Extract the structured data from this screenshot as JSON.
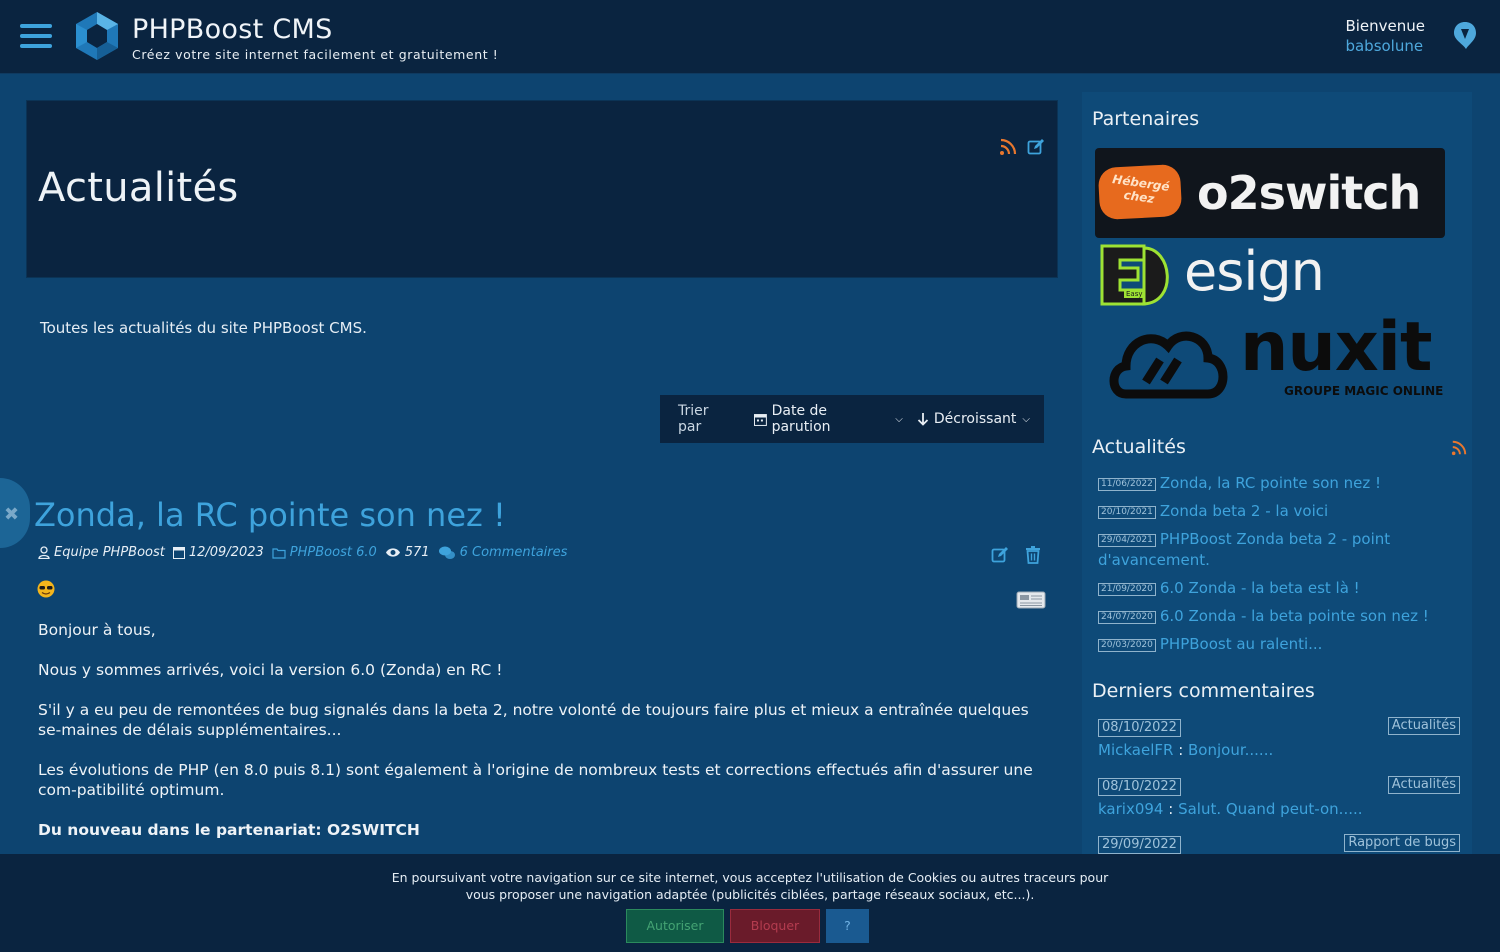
{
  "header": {
    "site_title": "PHPBoost CMS",
    "site_subtitle": "Créez votre site internet facilement et gratuitement !",
    "welcome": "Bienvenue",
    "username": "babsolune"
  },
  "main": {
    "page_title": "Actualités",
    "intro": "Toutes les actualités du site PHPBoost CMS.",
    "sort": {
      "label": "Trier par",
      "field": "Date de parution",
      "order": "Décroissant"
    },
    "article": {
      "title": "Zonda, la RC pointe son nez !",
      "author": "Equipe PHPBoost",
      "date": "12/09/2023",
      "category": "PHPBoost 6.0",
      "views": "571",
      "comments": "6 Commentaires",
      "paragraphs": [
        "Bonjour à tous,",
        "Nous y sommes arrivés, voici la version 6.0 (Zonda) en RC !",
        "S'il y a eu peu de remontées de bug signalés dans la beta 2, notre volonté de toujours faire plus et mieux a entraînée quelques se-maines de délais supplémentaires...",
        "Les évolutions de PHP (en 8.0 puis 8.1) sont également à l'origine de nombreux tests et corrections effectués afin d'assurer une com-patibilité optimum."
      ],
      "subheading": "Du nouveau dans le partenariat: O2SWITCH"
    }
  },
  "sidebar": {
    "partners_title": "Partenaires",
    "partners": {
      "o2switch_tag": "Hébergé chez",
      "o2switch_name": "o2switch",
      "edesign_name": "EDesign",
      "edesign_tag": "Easy",
      "nuxit_name": "nuxit",
      "nuxit_tag": "GROUPE MAGIC ONLINE"
    },
    "news_title": "Actualités",
    "news": [
      {
        "date": "11/06/2022",
        "title": "Zonda, la RC pointe son nez !"
      },
      {
        "date": "20/10/2021",
        "title": "Zonda beta 2 - la voici"
      },
      {
        "date": "29/04/2021",
        "title": "PHPBoost Zonda beta 2 - point d'avancement."
      },
      {
        "date": "21/09/2020",
        "title": "6.0 Zonda - la beta est là !"
      },
      {
        "date": "24/07/2020",
        "title": "6.0 Zonda - la beta pointe son nez !"
      },
      {
        "date": "20/03/2020",
        "title": "PHPBoost au ralenti..."
      }
    ],
    "comments_title": "Derniers commentaires",
    "comments": [
      {
        "date": "08/10/2022",
        "category": "Actualités",
        "author": "MickaelFR",
        "excerpt": "Bonjour......"
      },
      {
        "date": "08/10/2022",
        "category": "Actualités",
        "author": "karix094",
        "excerpt": "Salut. Quand peut-on....."
      },
      {
        "date": "29/09/2022",
        "category": "Rapport de bugs",
        "author": "",
        "excerpt": ""
      }
    ]
  },
  "cookie": {
    "line1": "En poursuivant votre navigation sur ce site internet, vous acceptez l'utilisation de Cookies ou autres traceurs pour",
    "line2": "vous proposer une navigation adaptée (publicités ciblées, partage réseaux sociaux, etc...).",
    "accept": "Autoriser",
    "block": "Bloquer",
    "help": "?"
  },
  "colors": {
    "background": "#0d4470",
    "header": "#0a2440",
    "accent": "#3ea3dc",
    "rss": "#e8772e"
  }
}
